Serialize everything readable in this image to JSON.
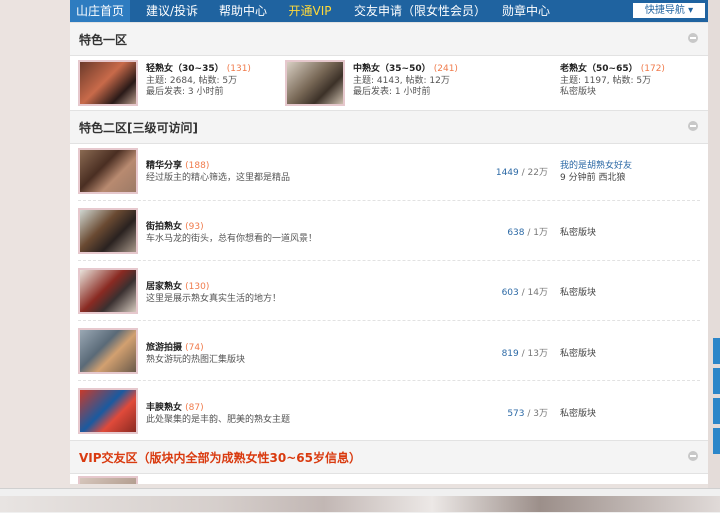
{
  "nav": {
    "items": [
      "山庄首页",
      "建议/投诉",
      "帮助中心",
      "开通VIP",
      "交友申请（限女性会员）",
      "勋章中心"
    ],
    "quick_nav": "快捷导航 ▾"
  },
  "section1": {
    "title": "特色一区",
    "forums": [
      {
        "name": "轻熟女（30~35）",
        "count": "(131)",
        "stats": "主题: 2684, 帖数: 5万",
        "last": "最后发表: 3 小时前"
      },
      {
        "name": "中熟女（35~50）",
        "count": "(241)",
        "stats": "主题: 4143, 帖数: 12万",
        "last": "最后发表: 1 小时前"
      },
      {
        "name": "老熟女（50~65）",
        "count": "(172)",
        "stats": "主题: 1197, 帖数: 5万",
        "last": "私密版块"
      }
    ]
  },
  "section2": {
    "title": "特色二区[三级可访问]",
    "forums": [
      {
        "name": "精华分享",
        "count": "(188)",
        "desc": "经过版主的精心筛选，这里都是精品",
        "num": "1449",
        "total": "/ 22万",
        "last1": "我的是胡熟女好友",
        "last2": "9 分钟前 西北狼"
      },
      {
        "name": "街拍熟女",
        "count": "(93)",
        "desc": "车水马龙的街头，总有你想看的一道风景！",
        "num": "638",
        "total": "/ 1万",
        "last1": "私密版块",
        "last2": ""
      },
      {
        "name": "居家熟女",
        "count": "(130)",
        "desc": "这里是展示熟女真实生活的地方！",
        "num": "603",
        "total": "/ 14万",
        "last1": "私密版块",
        "last2": ""
      },
      {
        "name": "旅游拍摄",
        "count": "(74)",
        "desc": "熟女游玩的热图汇集版块",
        "num": "819",
        "total": "/ 13万",
        "last1": "私密版块",
        "last2": ""
      },
      {
        "name": "丰腴熟女",
        "count": "(87)",
        "desc": "此处聚集的是丰韵、肥美的熟女主题",
        "num": "573",
        "total": "/ 3万",
        "last1": "私密版块",
        "last2": ""
      }
    ]
  },
  "section3": {
    "title": "VIP交友区（版块内全部为成熟女性30~65岁信息）"
  },
  "colors": {
    "nav_bg": "#1f63a0",
    "vip": "#ffd93a",
    "accent_red": "#d93a0f",
    "count": "#f07b4c",
    "link": "#2d6aa6"
  }
}
